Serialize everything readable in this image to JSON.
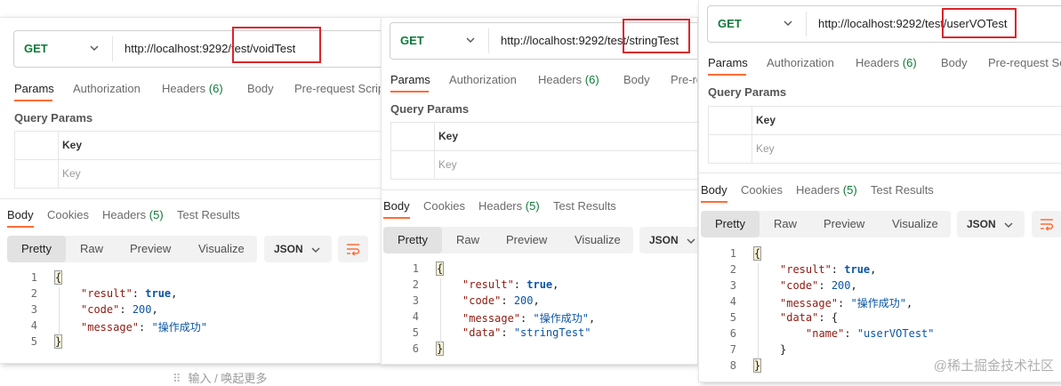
{
  "panels": [
    {
      "method": "GET",
      "url_prefix": "http://localhost:9292/te",
      "url_suffix": "st/voidTest",
      "tabs": [
        "Params",
        "Authorization",
        "Headers",
        "Body",
        "Pre-request Script"
      ],
      "headers_count": "(6)",
      "query_params_title": "Query Params",
      "key_header": "Key",
      "key_placeholder": "Key",
      "resp_tabs": [
        "Body",
        "Cookies",
        "Headers",
        "Test Results"
      ],
      "resp_headers_count": "(5)",
      "view_tabs": [
        "Pretty",
        "Raw",
        "Preview",
        "Visualize"
      ],
      "format": "JSON",
      "code_lines": [
        {
          "n": "1",
          "t": "{"
        },
        {
          "n": "2",
          "k": "\"result\"",
          "v": "true",
          "vt": "b",
          "tail": ","
        },
        {
          "n": "3",
          "k": "\"code\"",
          "v": "200",
          "vt": "n",
          "tail": ","
        },
        {
          "n": "4",
          "k": "\"message\"",
          "v": "\"操作成功\"",
          "vt": "s",
          "tail": ""
        },
        {
          "n": "5",
          "t": "}"
        }
      ]
    },
    {
      "method": "GET",
      "url_prefix": "http://localhost:9292/te",
      "url_suffix": "st/stringTest",
      "tabs": [
        "Params",
        "Authorization",
        "Headers",
        "Body",
        "Pre-re"
      ],
      "headers_count": "(6)",
      "query_params_title": "Query Params",
      "key_header": "Key",
      "key_placeholder": "Key",
      "resp_tabs": [
        "Body",
        "Cookies",
        "Headers",
        "Test Results"
      ],
      "resp_headers_count": "(5)",
      "view_tabs": [
        "Pretty",
        "Raw",
        "Preview",
        "Visualize"
      ],
      "format": "JSON",
      "code_lines": [
        {
          "n": "1",
          "t": "{"
        },
        {
          "n": "2",
          "k": "\"result\"",
          "v": "true",
          "vt": "b",
          "tail": ","
        },
        {
          "n": "3",
          "k": "\"code\"",
          "v": "200",
          "vt": "n",
          "tail": ","
        },
        {
          "n": "4",
          "k": "\"message\"",
          "v": "\"操作成功\"",
          "vt": "s",
          "tail": ","
        },
        {
          "n": "5",
          "k": "\"data\"",
          "v": "\"stringTest\"",
          "vt": "s",
          "tail": ""
        },
        {
          "n": "6",
          "t": "}"
        }
      ]
    },
    {
      "method": "GET",
      "url_prefix": "http://localhost:9292/te",
      "url_suffix": "st/userVOTest",
      "tabs": [
        "Params",
        "Authorization",
        "Headers",
        "Body",
        "Pre-request Sc"
      ],
      "headers_count": "(6)",
      "query_params_title": "Query Params",
      "key_header": "Key",
      "key_placeholder": "Key",
      "resp_tabs": [
        "Body",
        "Cookies",
        "Headers",
        "Test Results"
      ],
      "resp_headers_count": "(5)",
      "view_tabs": [
        "Pretty",
        "Raw",
        "Preview",
        "Visualize"
      ],
      "format": "JSON",
      "code_lines": [
        {
          "n": "1",
          "t": "{"
        },
        {
          "n": "2",
          "k": "\"result\"",
          "v": "true",
          "vt": "b",
          "tail": ","
        },
        {
          "n": "3",
          "k": "\"code\"",
          "v": "200",
          "vt": "n",
          "tail": ","
        },
        {
          "n": "4",
          "k": "\"message\"",
          "v": "\"操作成功\"",
          "vt": "s",
          "tail": ","
        },
        {
          "n": "5",
          "k": "\"data\"",
          "v": "{",
          "vt": "p",
          "tail": ""
        },
        {
          "n": "6",
          "k": "\"name\"",
          "v": "\"userVOTest\"",
          "vt": "s",
          "tail": "",
          "indent": 2
        },
        {
          "n": "7",
          "t": "}",
          "indent": 1
        },
        {
          "n": "8",
          "t": "}"
        }
      ]
    }
  ],
  "footer_hint": "输入 / 唤起更多",
  "watermark": "@稀土掘金技术社区",
  "colors": {
    "accent": "#ff6c37",
    "get_method": "#0f7a3a",
    "highlight_box": "#d9262c"
  }
}
